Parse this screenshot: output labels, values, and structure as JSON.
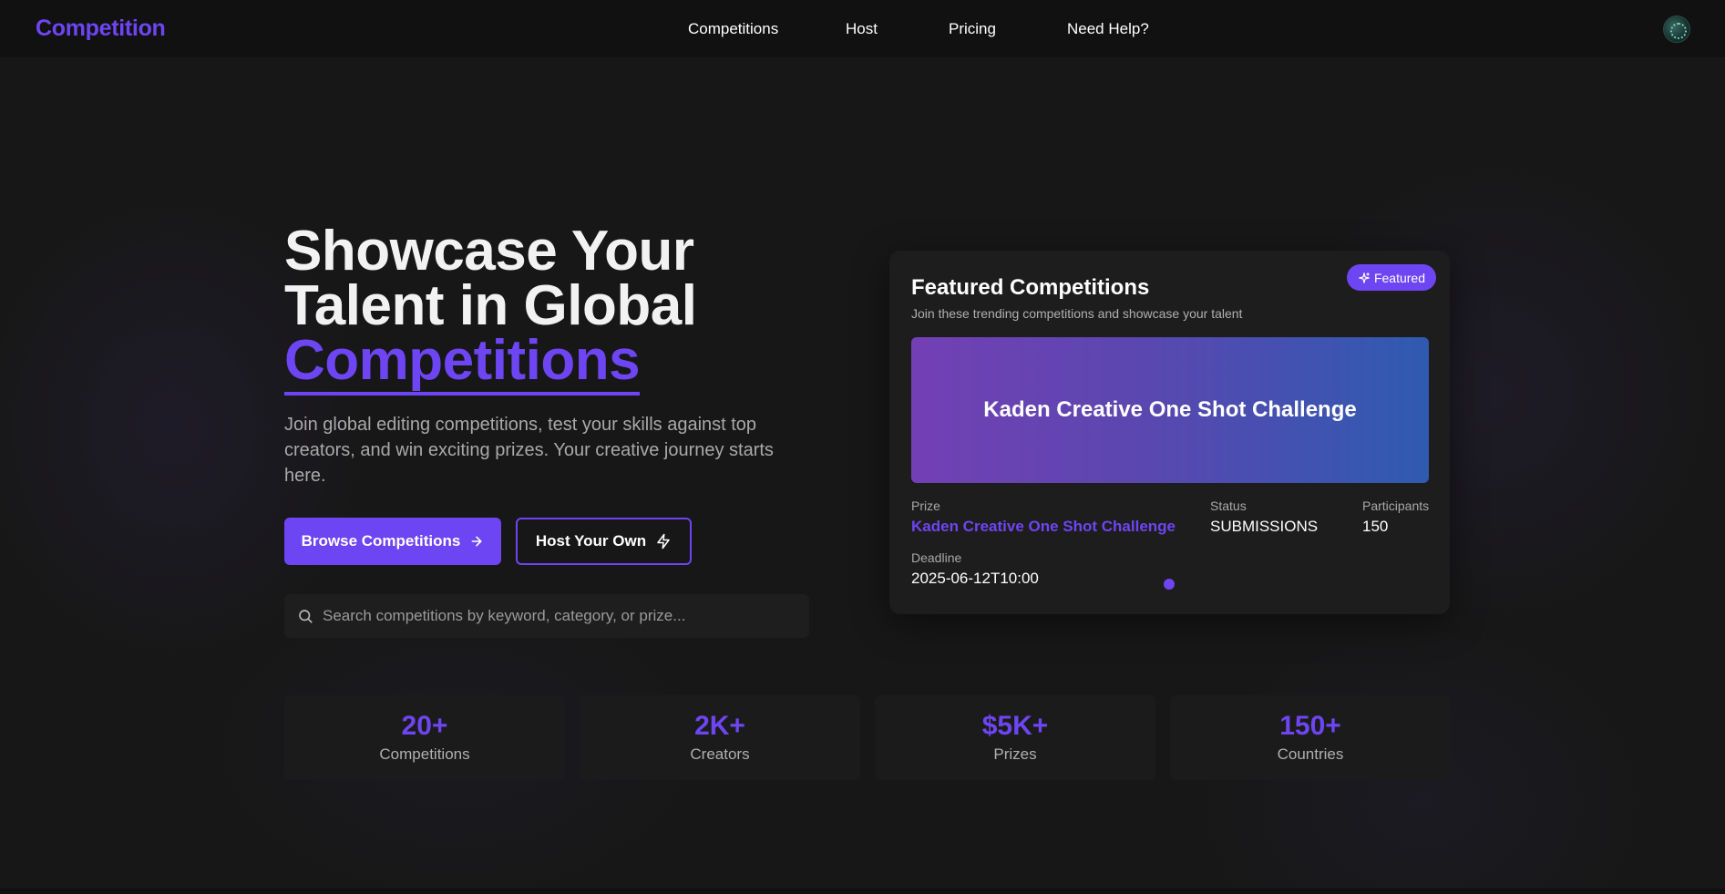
{
  "app": {
    "logo": "Competition"
  },
  "nav": {
    "links": [
      "Competitions",
      "Host",
      "Pricing",
      "Need Help?"
    ],
    "avatar_icon": "user-avatar"
  },
  "hero": {
    "title_line1": "Showcase Your",
    "title_line2": "Talent in Global",
    "title_accent": "Competitions",
    "description": "Join global editing competitions, test your skills against top creators, and win exciting prizes. Your creative journey starts here.",
    "browse_label": "Browse Competitions",
    "host_label": "Host Your Own",
    "search_placeholder": "Search competitions by keyword, category, or prize...",
    "accent_color": "#6d45f2"
  },
  "featured": {
    "title": "Featured Competitions",
    "subtitle": "Join these trending competitions and showcase your talent",
    "badge": "Featured",
    "banner_title": "Kaden Creative One Shot Challenge",
    "prize_label": "Prize",
    "prize_value": "Kaden Creative One Shot Challenge",
    "status_label": "Status",
    "status_value": "SUBMISSIONS",
    "participants_label": "Participants",
    "participants_value": "150",
    "deadline_label": "Deadline",
    "deadline_value": "2025-06-12T10:00"
  },
  "stats": [
    {
      "value": "20+",
      "label": "Competitions"
    },
    {
      "value": "2K+",
      "label": "Creators"
    },
    {
      "value": "$5K+",
      "label": "Prizes"
    },
    {
      "value": "150+",
      "label": "Countries"
    }
  ]
}
